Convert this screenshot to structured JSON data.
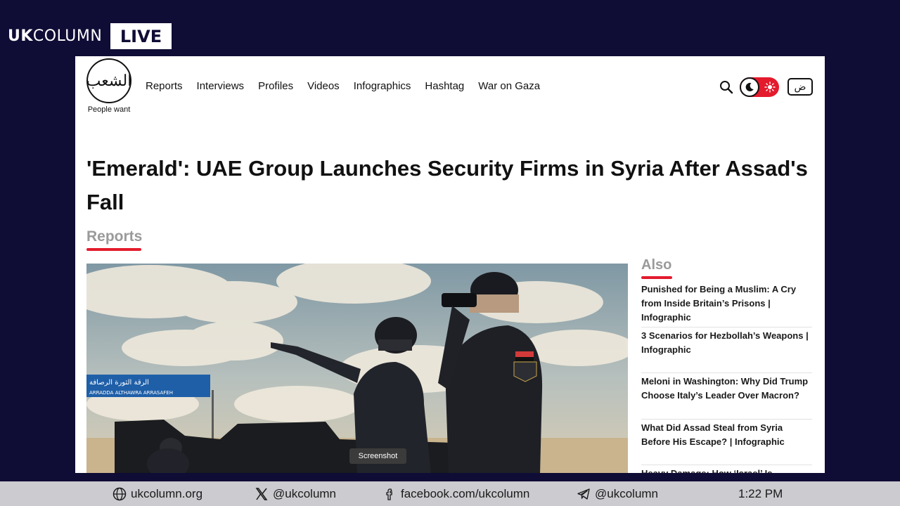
{
  "broadcast": {
    "brand_bold": "UK",
    "brand_rest": "COLUMN",
    "live_label": "LIVE"
  },
  "site": {
    "logo_caption": "People want",
    "logo_glyph": "الشعب",
    "nav": [
      "Reports",
      "Interviews",
      "Profiles",
      "Videos",
      "Infographics",
      "Hashtag",
      "War on Gaza"
    ],
    "lang_button": "ض",
    "icons": {
      "search": "search-icon",
      "theme": "moon-icon",
      "sun": "sun-icon"
    },
    "accent_color": "#e31b2d"
  },
  "article": {
    "headline": "'Emerald': UAE Group Launches Security Firms in Syria After Assad's Fall",
    "section": "Reports",
    "road_sign": "ARRADDA  ALTHAWRA  ARRASAFEH",
    "road_sign_ar": "الرقة  الثورة  الرصافة"
  },
  "sidebar": {
    "title": "Also",
    "items": [
      "Punished for Being a Muslim: A Cry from Inside Britain’s Prisons | Infographic",
      "3 Scenarios for Hezbollah’s Weapons | Infographic",
      "Meloni in Washington: Why Did Trump Choose Italy’s Leader Over Macron?",
      "What Did Assad Steal from Syria Before His Escape? | Infographic",
      "Heavy Damage: How ‘Israel’ Is Targeting"
    ]
  },
  "tooltip": "Screenshot",
  "footer": {
    "website": "ukcolumn.org",
    "x_handle": "@ukcolumn",
    "facebook": "facebook.com/ukcolumn",
    "telegram": "@ukcolumn",
    "time": "1:22 PM"
  }
}
